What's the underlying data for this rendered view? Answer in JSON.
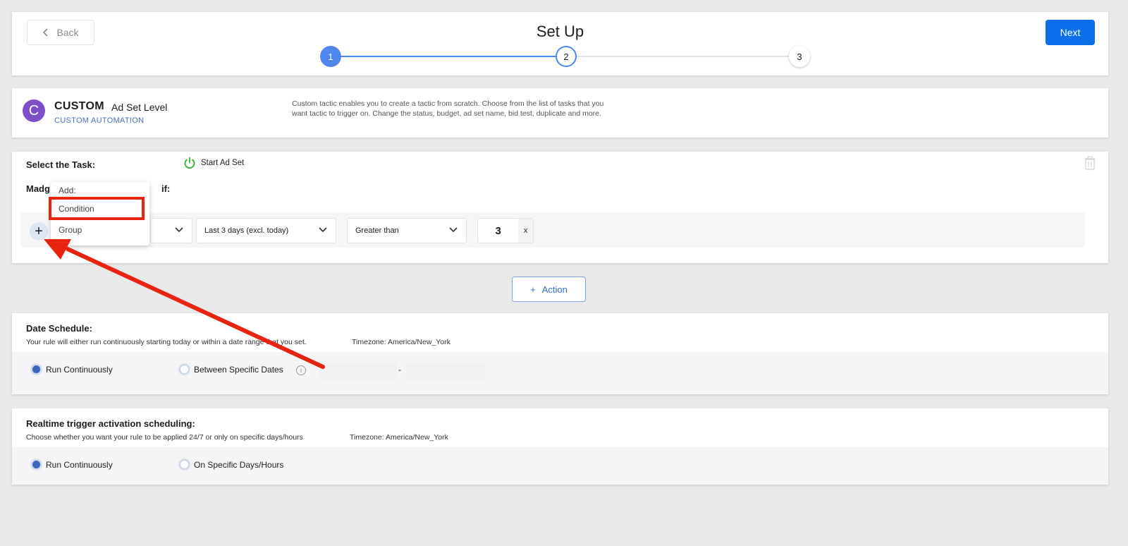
{
  "header": {
    "back_label": "Back",
    "title": "Set Up",
    "next_label": "Next",
    "steps": [
      "1",
      "2",
      "3"
    ]
  },
  "custom": {
    "logo_letter": "C",
    "title": "CUSTOM",
    "level": "Ad Set Level",
    "subtitle": "CUSTOM AUTOMATION",
    "description": "Custom tactic enables you to create a tactic from scratch. Choose from the list of tasks that you want tactic to trigger on. Change the status, budget, ad set name, bid test, duplicate and more."
  },
  "task": {
    "label": "Select the Task:",
    "value": "Start Ad Set",
    "rule_label_start": "Madg",
    "rule_label_end": "if:"
  },
  "condition": {
    "period": "Last 3 days (excl. today)",
    "operator": "Greater than",
    "value": "3",
    "unit": "x"
  },
  "add_menu": {
    "heading": "Add:",
    "items": [
      "Condition",
      "Group"
    ]
  },
  "action_label": "Action",
  "date_schedule": {
    "title": "Date Schedule:",
    "description": "Your rule will either run continuously starting today or within a date range that you set.",
    "timezone": "Timezone: America/New_York",
    "options": [
      "Run Continuously",
      "Between Specific Dates"
    ],
    "selected": 0,
    "date_separator": "-"
  },
  "realtime": {
    "title": "Realtime trigger activation scheduling:",
    "description": "Choose whether you want your rule to be applied 24/7 or only on specific days/hours",
    "timezone": "Timezone: America/New_York",
    "options": [
      "Run Continuously",
      "On Specific Days/Hours"
    ],
    "selected": 0
  },
  "colors": {
    "primary": "#0a6fe8",
    "step_active": "#4e88ee",
    "logo": "#7e4ec9",
    "annotation": "#e8230f",
    "power_icon": "#2eb135"
  }
}
